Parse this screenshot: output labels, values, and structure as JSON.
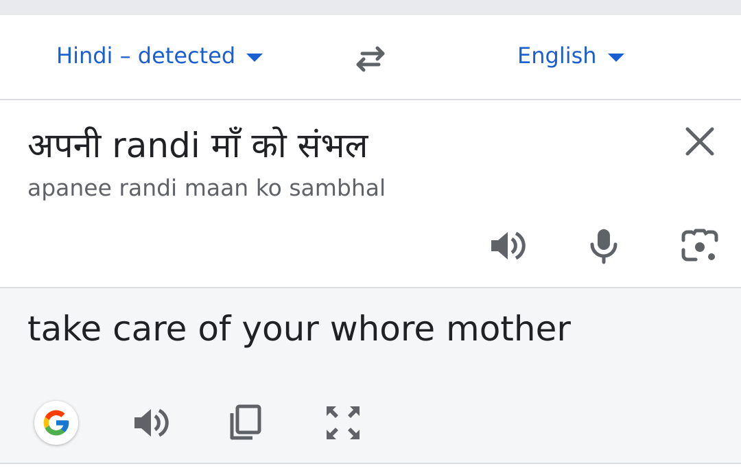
{
  "languages": {
    "source_label": "Hindi – detected",
    "target_label": "English"
  },
  "source": {
    "text": "अपनी randi माँ को संभल",
    "transliteration": "apanee randi maan ko sambhal"
  },
  "result": {
    "text": "take care of your whore mother"
  },
  "icons": {
    "swap": "swap-arrows-icon",
    "clear": "close-icon",
    "listen": "speaker-icon",
    "mic": "microphone-icon",
    "camera": "camera-icon",
    "google": "google-logo",
    "copy": "copy-icon",
    "fullscreen": "fullscreen-icon"
  },
  "colors": {
    "accent": "#1a5fd1",
    "text": "#202124",
    "secondary_text": "#5f6368",
    "icon": "#5f6368",
    "result_bg": "#f5f6f8"
  }
}
